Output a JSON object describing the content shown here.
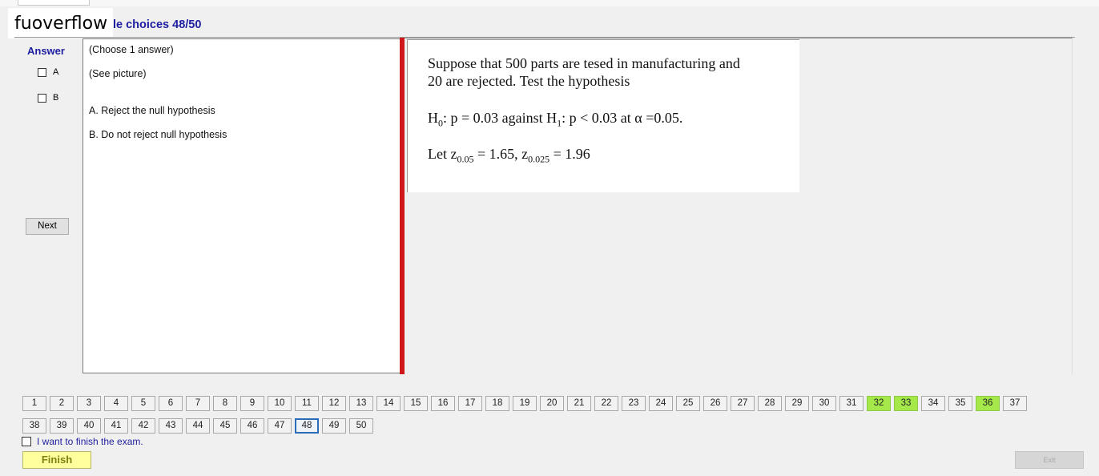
{
  "brand": {
    "text": "fuoverflow"
  },
  "header": {
    "section_title": "le choices 48/50"
  },
  "answer_panel": {
    "label": "Answer",
    "options": [
      {
        "label": "A",
        "checked": false
      },
      {
        "label": "B",
        "checked": false
      }
    ],
    "next_label": "Next"
  },
  "question": {
    "instruction": "(Choose 1 answer)",
    "picture_note": "(See picture)",
    "choices": [
      "A.  Reject the null hypothesis",
      "B.  Do not reject null hypothesis"
    ]
  },
  "picture": {
    "line1": "Suppose that 500 parts are tesed in manufacturing and",
    "line2": "20 are rejected. Test the hypothesis",
    "h0_main": "H",
    "h0_sub": "0",
    "h0_rest": ": p = 0.03 against H",
    "h1_sub": "1",
    "h1_rest": ": p < 0.03 at α =0.05.",
    "z_prefix": "Let z",
    "z1_sub": "0.05",
    "z1_rest": " = 1.65, z",
    "z2_sub": "0.025",
    "z2_rest": " = 1.96"
  },
  "navigation": {
    "row1": [
      "1",
      "2",
      "3",
      "4",
      "5",
      "6",
      "7",
      "8",
      "9",
      "10",
      "11",
      "12",
      "13",
      "14",
      "15",
      "16",
      "17",
      "18",
      "19",
      "20",
      "21",
      "22",
      "23",
      "24",
      "25",
      "26",
      "27",
      "28",
      "29",
      "30",
      "31",
      "32",
      "33",
      "34",
      "35",
      "36",
      "37"
    ],
    "row2": [
      "38",
      "39",
      "40",
      "41",
      "42",
      "43",
      "44",
      "45",
      "46",
      "47",
      "48",
      "49",
      "50"
    ],
    "answered": [
      "32",
      "33",
      "36"
    ],
    "current": "48"
  },
  "footer": {
    "finish_check_label": "I want to finish the exam.",
    "finish_label": "Finish",
    "exit_label": "Exit"
  },
  "colors": {
    "accent_text": "#1e1ea0",
    "divider": "#d0181a",
    "answered": "#a4e84a",
    "finish_bg": "#ffff9e"
  }
}
